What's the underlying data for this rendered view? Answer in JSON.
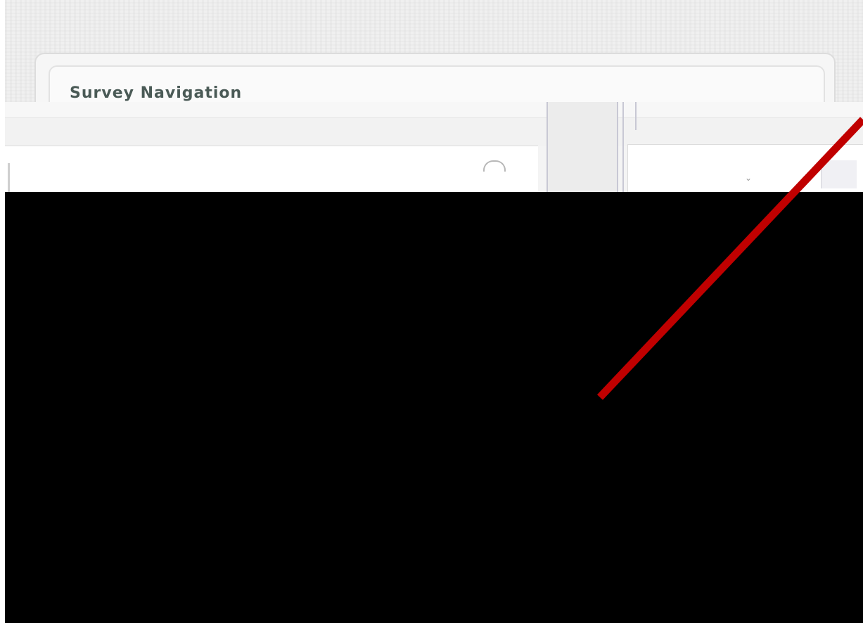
{
  "panel": {
    "title": "Survey Navigation"
  },
  "colors": {
    "title": "#4a5a56",
    "overlay": "#000000",
    "annotation_line": "#c00000",
    "background": "#f4f4f4"
  },
  "icons": {
    "row_icon": "arc-icon",
    "field_chevron": "chevron-down-icon"
  }
}
